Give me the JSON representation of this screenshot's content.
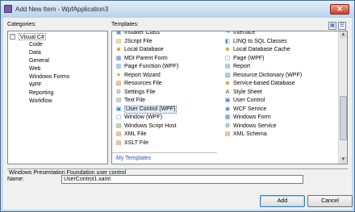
{
  "window": {
    "title": "Add New Item - WpfApplication3",
    "close_glyph": "✕"
  },
  "categories": {
    "label": "Categories:",
    "root": "Visual C#",
    "items": [
      "Code",
      "Data",
      "General",
      "Web",
      "Windows Forms",
      "WPF",
      "Reporting",
      "Workflow"
    ]
  },
  "templates": {
    "label": "Templates:",
    "left": [
      {
        "label": "Installer Class",
        "icon": "installer-icon",
        "glyph": "▣",
        "color": "#6a7fa8"
      },
      {
        "label": "JScript File",
        "icon": "jscript-icon",
        "glyph": "▤",
        "color": "#c69a2a"
      },
      {
        "label": "Local Database",
        "icon": "database-icon",
        "glyph": "◙",
        "color": "#c9a23b"
      },
      {
        "label": "MDI Parent Form",
        "icon": "form-icon",
        "glyph": "▦",
        "color": "#4d7cc2"
      },
      {
        "label": "Page Function (WPF)",
        "icon": "page-function-icon",
        "glyph": "▥",
        "color": "#3b7dd8"
      },
      {
        "label": "Report Wizard",
        "icon": "report-wizard-icon",
        "glyph": "★",
        "color": "#d0a020"
      },
      {
        "label": "Resources File",
        "icon": "resources-icon",
        "glyph": "▧",
        "color": "#b07a30"
      },
      {
        "label": "Settings File",
        "icon": "settings-icon",
        "glyph": "⚙",
        "color": "#777777"
      },
      {
        "label": "Text File",
        "icon": "text-file-icon",
        "glyph": "▤",
        "color": "#808080"
      },
      {
        "label": "User Control (WPF)",
        "icon": "user-control-icon",
        "glyph": "▣",
        "color": "#3b7dd8"
      },
      {
        "label": "Window (WPF)",
        "icon": "window-icon",
        "glyph": "▢",
        "color": "#3b7dd8"
      },
      {
        "label": "Windows Script Host",
        "icon": "script-host-icon",
        "glyph": "▤",
        "color": "#5a8a3a"
      },
      {
        "label": "XML File",
        "icon": "xml-file-icon",
        "glyph": "▤",
        "color": "#c06a2a"
      },
      {
        "label": "XSLT File",
        "icon": "xslt-file-icon",
        "glyph": "▤",
        "color": "#c06a2a"
      }
    ],
    "right": [
      {
        "label": "Interface",
        "icon": "interface-icon",
        "glyph": "⊸",
        "color": "#3b7dd8"
      },
      {
        "label": "LINQ to SQL Classes",
        "icon": "linq-icon",
        "glyph": "◧",
        "color": "#4a90c8"
      },
      {
        "label": "Local Database Cache",
        "icon": "db-cache-icon",
        "glyph": "◙",
        "color": "#c9a23b"
      },
      {
        "label": "Page (WPF)",
        "icon": "page-icon",
        "glyph": "▢",
        "color": "#3b7dd8"
      },
      {
        "label": "Report",
        "icon": "report-icon",
        "glyph": "▤",
        "color": "#3b7dd8"
      },
      {
        "label": "Resource Dictionary (WPF)",
        "icon": "resource-dictionary-icon",
        "glyph": "▧",
        "color": "#3b7dd8"
      },
      {
        "label": "Service-based Database",
        "icon": "service-db-icon",
        "glyph": "◙",
        "color": "#c9a23b"
      },
      {
        "label": "Style Sheet",
        "icon": "style-sheet-icon",
        "glyph": "A",
        "color": "#444444"
      },
      {
        "label": "User Control",
        "icon": "user-control-winforms-icon",
        "glyph": "▣",
        "color": "#4d7cc2"
      },
      {
        "label": "WCF Service",
        "icon": "wcf-service-icon",
        "glyph": "◉",
        "color": "#3b7dd8"
      },
      {
        "label": "Windows Form",
        "icon": "windows-form-icon",
        "glyph": "▦",
        "color": "#4d7cc2"
      },
      {
        "label": "Windows Service",
        "icon": "windows-service-icon",
        "glyph": "⚙",
        "color": "#6a6a6a"
      },
      {
        "label": "XML Schema",
        "icon": "xml-schema-icon",
        "glyph": "▤",
        "color": "#c06a2a"
      }
    ],
    "my_templates": "My Templates",
    "selected": "User Control (WPF)"
  },
  "description": "Windows Presentation Foundation user control",
  "name": {
    "label": "Name:",
    "value": "UserControl1.xaml"
  },
  "buttons": {
    "add": "Add",
    "cancel": "Cancel"
  }
}
